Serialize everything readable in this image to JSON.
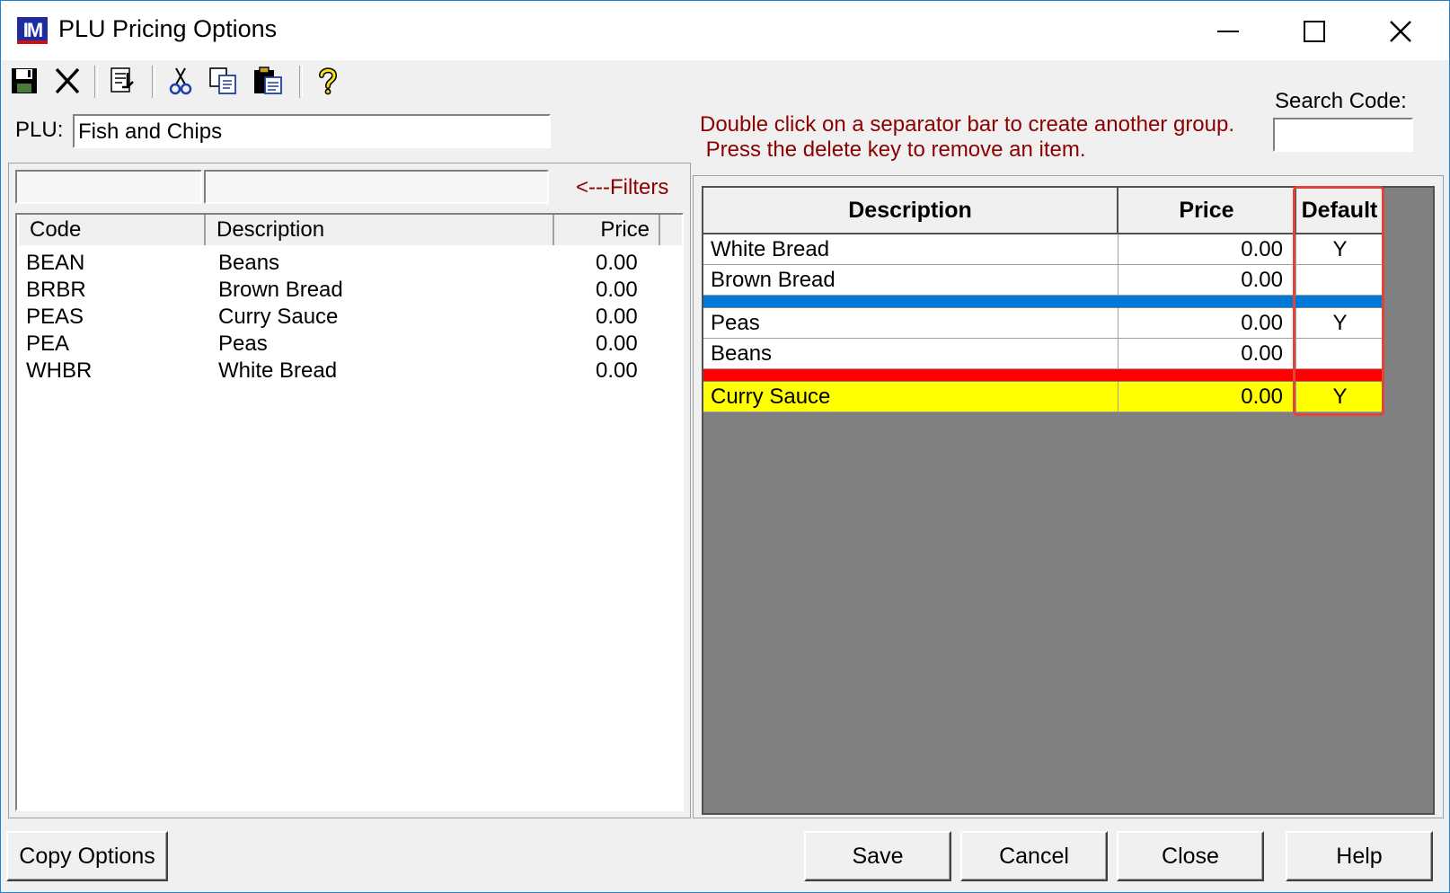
{
  "window": {
    "title": "PLU Pricing Options",
    "app_icon_text": "IM"
  },
  "toolbar": {
    "icons": [
      "save-icon",
      "delete-icon",
      "export-icon",
      "cut-icon",
      "copy-icon",
      "paste-icon",
      "help-icon"
    ]
  },
  "plu": {
    "label": "PLU:",
    "value": "Fish and Chips"
  },
  "search": {
    "label": "Search Code:",
    "value": ""
  },
  "message": "Double click on a separator bar to create another group.\n Press the delete key to remove an item.",
  "filters": {
    "label": "<---Filters",
    "filter1": "",
    "filter2": ""
  },
  "left_list": {
    "columns": [
      "Code",
      "Description",
      "Price"
    ],
    "rows": [
      {
        "code": "BEAN",
        "description": "Beans",
        "price": "0.00"
      },
      {
        "code": "BRBR",
        "description": "Brown Bread",
        "price": "0.00"
      },
      {
        "code": "PEAS",
        "description": "Curry Sauce",
        "price": "0.00"
      },
      {
        "code": "PEA",
        "description": "Peas",
        "price": "0.00"
      },
      {
        "code": "WHBR",
        "description": "White Bread",
        "price": "0.00"
      }
    ]
  },
  "options_grid": {
    "columns": [
      "Description",
      "Price",
      "Default"
    ],
    "groups": [
      {
        "items": [
          {
            "description": "White Bread",
            "price": "0.00",
            "default": "Y"
          },
          {
            "description": "Brown Bread",
            "price": "0.00",
            "default": ""
          }
        ],
        "separator_color": "#0078d7"
      },
      {
        "items": [
          {
            "description": "Peas",
            "price": "0.00",
            "default": "Y"
          },
          {
            "description": "Beans",
            "price": "0.00",
            "default": ""
          }
        ],
        "separator_color": "#ff0000"
      },
      {
        "items": [
          {
            "description": "Curry Sauce",
            "price": "0.00",
            "default": "Y"
          }
        ],
        "row_color": "#ffff00"
      }
    ]
  },
  "buttons": {
    "copy_options": "Copy Options",
    "save": "Save",
    "cancel": "Cancel",
    "close": "Close",
    "help": "Help"
  },
  "colors": {
    "message": "#8b0000",
    "grid_background": "#808080",
    "highlight_border": "#e0453a"
  }
}
